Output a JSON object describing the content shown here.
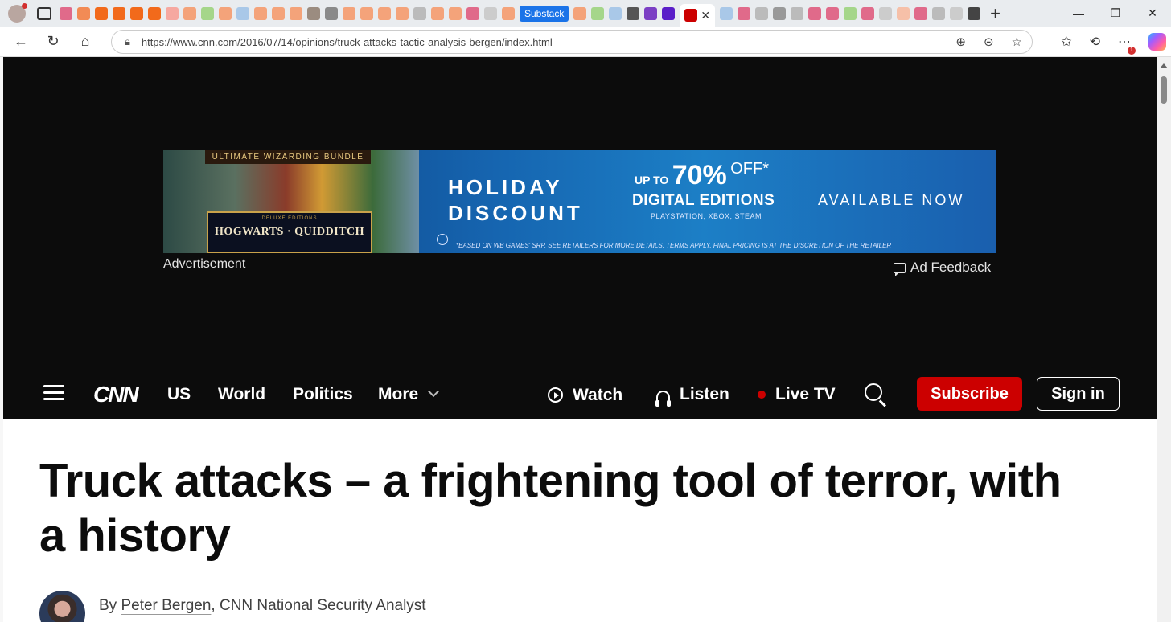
{
  "browser": {
    "tabs": {
      "substack_label": "Substack",
      "active_close": "✕",
      "new_tab": "+"
    },
    "window_controls": [
      "—",
      "❐",
      "✕"
    ],
    "address": {
      "url": "https://www.cnn.com/2016/07/14/opinions/truck-attacks-tactic-analysis-bergen/index.html"
    },
    "extension_badge": "1"
  },
  "ad": {
    "banner": {
      "bundle_title": "ULTIMATE WIZARDING BUNDLE",
      "edition": "DELUXE EDITIONS",
      "games": "HOGWARTS · QUIDDITCH",
      "holiday_line1": "HOLIDAY",
      "holiday_line2": "DISCOUNT",
      "up_to": "UP TO",
      "percent": "70%",
      "off": "OFF*",
      "digital_editions": "DIGITAL EDITIONS",
      "platforms": "PLAYSTATION, XBOX, STEAM",
      "available": "AVAILABLE NOW",
      "legal": "*BASED ON WB GAMES' SRP. SEE RETAILERS FOR MORE DETAILS. TERMS APPLY. FINAL PRICING IS AT THE DISCRETION OF THE RETAILER"
    },
    "label": "Advertisement",
    "feedback": "Ad Feedback"
  },
  "nav": {
    "logo": "CNN",
    "links": [
      "US",
      "World",
      "Politics",
      "More"
    ],
    "watch": "Watch",
    "listen": "Listen",
    "live_tv": "Live TV",
    "subscribe": "Subscribe",
    "sign_in": "Sign in"
  },
  "article": {
    "headline": "Truck attacks – a frightening tool of terror, with a history",
    "byline_prefix": "By ",
    "author": "Peter Bergen",
    "author_title": ", CNN National Security Analyst"
  }
}
